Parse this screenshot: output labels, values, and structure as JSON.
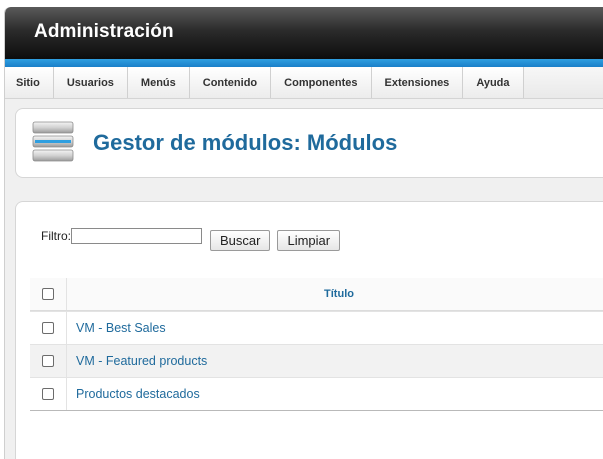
{
  "app": {
    "title": "Administración"
  },
  "menu": {
    "items": [
      {
        "label": "Sitio"
      },
      {
        "label": "Usuarios"
      },
      {
        "label": "Menús"
      },
      {
        "label": "Contenido"
      },
      {
        "label": "Componentes"
      },
      {
        "label": "Extensiones"
      },
      {
        "label": "Ayuda"
      }
    ]
  },
  "header": {
    "title": "Gestor de módulos: Módulos",
    "icon": "module-stack-icon"
  },
  "filter": {
    "label": "Filtro:",
    "value": "",
    "search_button": "Buscar",
    "clear_button": "Limpiar"
  },
  "table": {
    "columns": {
      "title": "Título"
    },
    "rows": [
      {
        "title": "VM - Best Sales"
      },
      {
        "title": "VM - Featured products"
      },
      {
        "title": "Productos destacados"
      }
    ]
  },
  "colors": {
    "accent": "#1a7fc8",
    "title_blue": "#1f6a9c",
    "topbar_dark": "#0d0d0d"
  }
}
